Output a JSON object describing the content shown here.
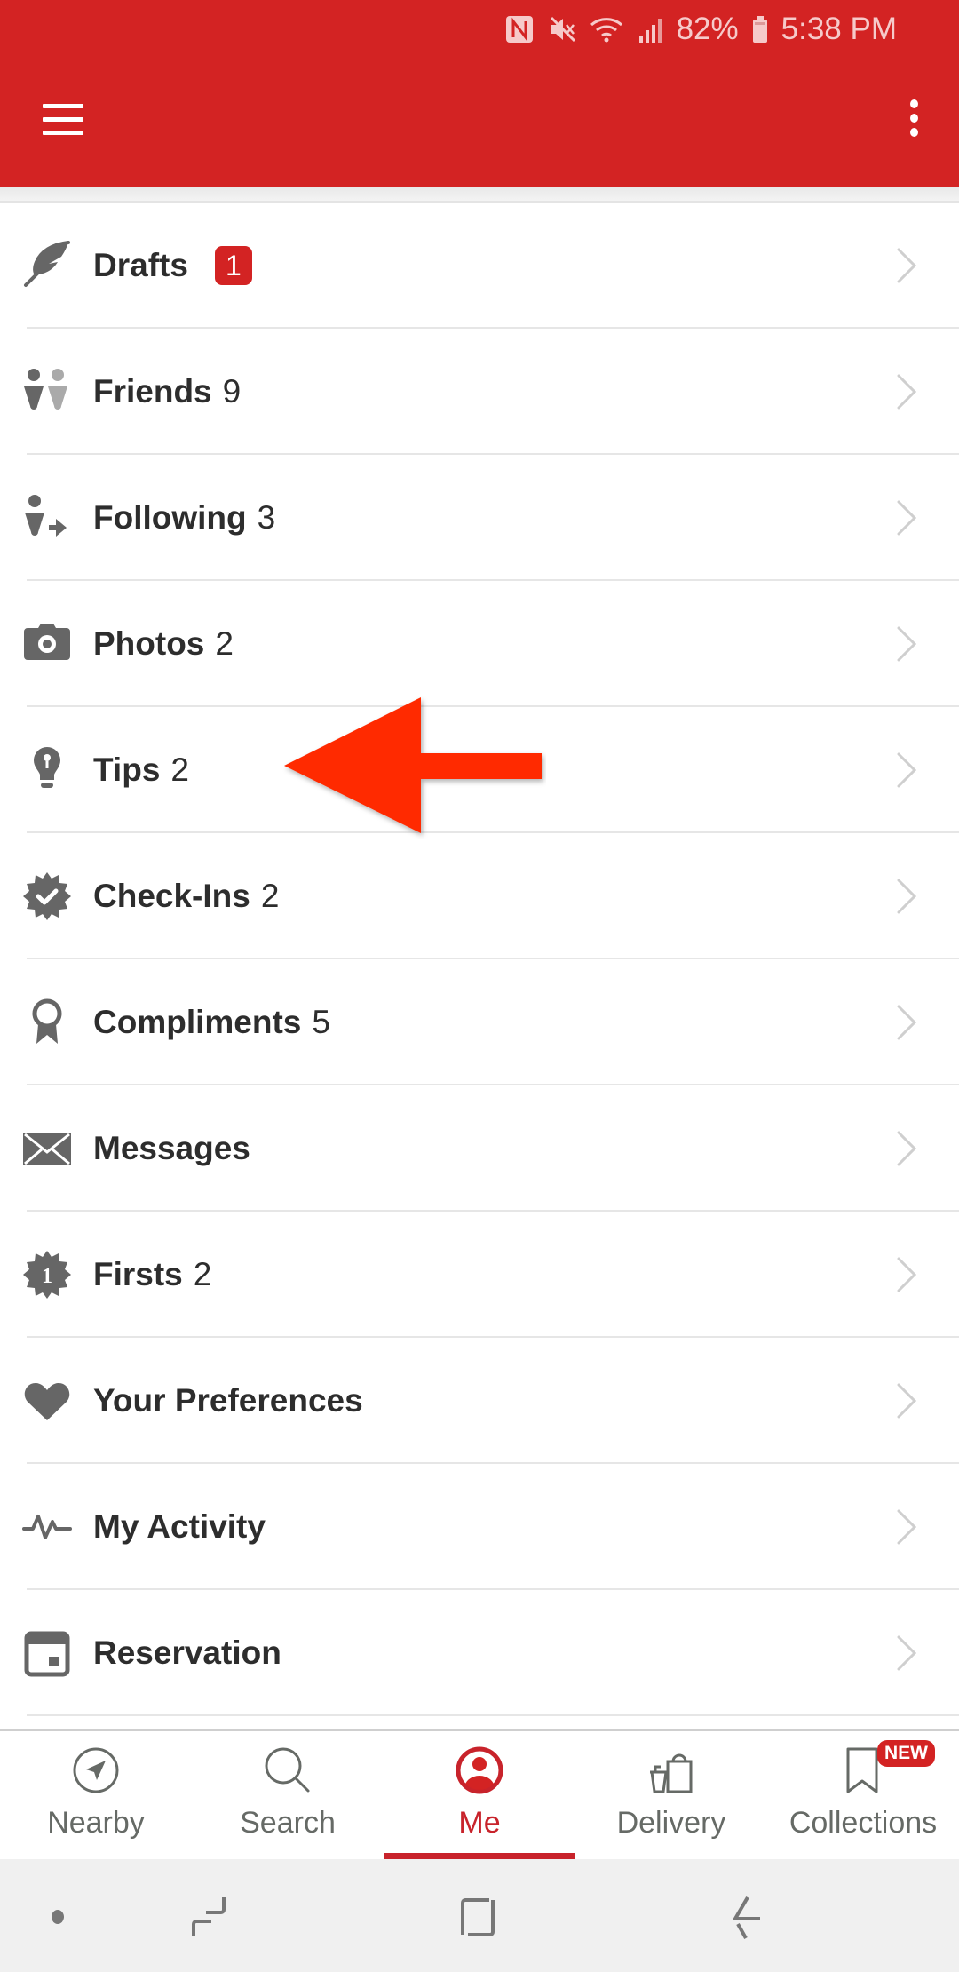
{
  "status_bar": {
    "icons": [
      "nfc-icon",
      "mute-icon",
      "wifi-icon",
      "signal-icon"
    ],
    "battery": "82%",
    "time": "5:38 PM"
  },
  "app_bar": {
    "menu_icon": "hamburger-menu-icon",
    "overflow_icon": "more-vert-icon"
  },
  "list": {
    "items": [
      {
        "label": "Drafts",
        "badge": "1",
        "icon": "feather-icon"
      },
      {
        "label": "Friends",
        "count": "9",
        "icon": "friends-icon"
      },
      {
        "label": "Following",
        "count": "3",
        "icon": "following-icon"
      },
      {
        "label": "Photos",
        "count": "2",
        "icon": "camera-icon"
      },
      {
        "label": "Tips",
        "count": "2",
        "icon": "lightbulb-icon"
      },
      {
        "label": "Check-Ins",
        "count": "2",
        "icon": "check-badge-icon"
      },
      {
        "label": "Compliments",
        "count": "5",
        "icon": "award-ribbon-icon"
      },
      {
        "label": "Messages",
        "icon": "envelope-icon"
      },
      {
        "label": "Firsts",
        "count": "2",
        "icon": "firsts-badge-icon"
      },
      {
        "label": "Your Preferences",
        "icon": "heart-icon"
      },
      {
        "label": "My Activity",
        "icon": "activity-pulse-icon"
      },
      {
        "label": "Reservation",
        "icon": "calendar-icon"
      }
    ],
    "chevron_icon": "chevron-right-icon"
  },
  "annotation": {
    "pointing_to": "Tips",
    "color": "#ff2a00"
  },
  "bottom_nav": {
    "tabs": [
      {
        "label": "Nearby",
        "icon": "navigation-arrow-icon",
        "active": false
      },
      {
        "label": "Search",
        "icon": "search-icon",
        "active": false
      },
      {
        "label": "Me",
        "icon": "user-profile-icon",
        "active": true
      },
      {
        "label": "Delivery",
        "icon": "delivery-bag-icon",
        "active": false
      },
      {
        "label": "Collections",
        "icon": "bookmark-icon",
        "active": false,
        "badge": "NEW"
      }
    ]
  },
  "system_nav": {
    "buttons": [
      "dot-indicator",
      "recent-apps",
      "home",
      "back"
    ]
  },
  "colors": {
    "brand_red": "#d32323",
    "active_tab": "#c8232b",
    "icon_gray": "#666666",
    "text_dark": "#2d2d2d"
  }
}
